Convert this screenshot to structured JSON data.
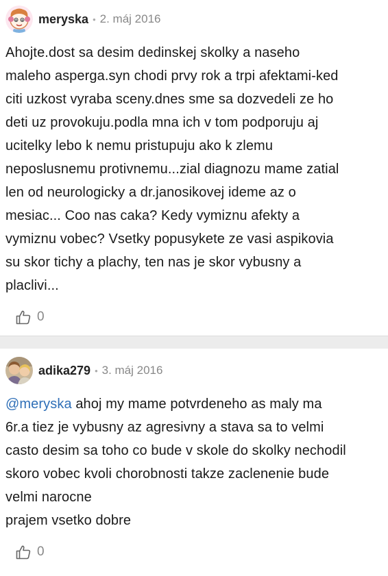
{
  "comments": [
    {
      "author": "meryska",
      "date": "2. máj 2016",
      "body_lines": [
        "Ahojte.dost sa desim dedinskej skolky a naseho",
        "maleho asperga.syn chodi prvy rok a trpi afektami-ked",
        "citi uzkost vyraba sceny.dnes sme sa dozvedeli ze ho",
        "deti uz provokuju.podla mna ich v tom podporuju aj",
        "ucitelky lebo k nemu pristupuju ako k zlemu",
        "neposlusnemu protivnemu...zial diagnozu mame zatial",
        "len od neurologicky a dr.janosikovej ideme az o",
        "mesiac... Coo nas caka? Kedy vymiznu afekty a",
        "vymiznu vobec? Vsetky popusykete ze vasi aspikovia",
        "su skor tichy a plachy, ten nas je skor vybusny a",
        "placlivi..."
      ],
      "likes": "0"
    },
    {
      "author": "adika279",
      "date": "3. máj 2016",
      "mention": "@meryska",
      "first_line_rest": " ahoj my mame potvrdeneho as maly ma",
      "body_lines": [
        "6r.a tiez je vybusny az agresivny a stava sa to velmi",
        "casto desim sa toho co bude v skole do skolky nechodil",
        "skoro vobec kvoli chorobnosti takze zaclenenie bude",
        "velmi narocne",
        "prajem vsetko dobre"
      ],
      "likes": "0"
    }
  ],
  "colors": {
    "mention": "#2f6fb7",
    "meta": "#888888",
    "separator": "#ececec"
  },
  "icons": {
    "like": "thumbs-up-outline-icon"
  }
}
